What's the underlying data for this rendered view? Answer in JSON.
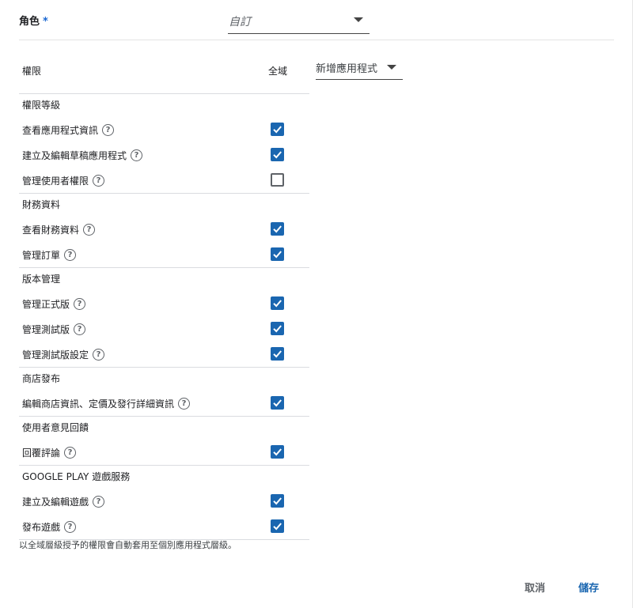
{
  "role": {
    "label": "角色",
    "required_mark": "*",
    "value": "自訂"
  },
  "app_select": {
    "value": "新增應用程式"
  },
  "table": {
    "header_permission": "權限",
    "header_global": "全域",
    "groups": [
      {
        "title": "權限等級",
        "items": [
          {
            "label": "查看應用程式資訊",
            "checked": true
          },
          {
            "label": "建立及編輯草稿應用程式",
            "checked": true
          },
          {
            "label": "管理使用者權限",
            "checked": false
          }
        ]
      },
      {
        "title": "財務資料",
        "items": [
          {
            "label": "查看財務資料",
            "checked": true
          },
          {
            "label": "管理訂單",
            "checked": true
          }
        ]
      },
      {
        "title": "版本管理",
        "items": [
          {
            "label": "管理正式版",
            "checked": true
          },
          {
            "label": "管理測試版",
            "checked": true
          },
          {
            "label": "管理測試版設定",
            "checked": true
          }
        ]
      },
      {
        "title": "商店發布",
        "items": [
          {
            "label": "編輯商店資訊、定價及發行詳細資訊",
            "checked": true
          }
        ]
      },
      {
        "title": "使用者意見回饋",
        "items": [
          {
            "label": "回覆評論",
            "checked": true
          }
        ]
      },
      {
        "title": "GOOGLE PLAY 遊戲服務",
        "items": [
          {
            "label": "建立及編輯遊戲",
            "checked": true
          },
          {
            "label": "發布遊戲",
            "checked": true
          }
        ]
      }
    ]
  },
  "help_glyph": "?",
  "footnote": "以全域層級授予的權限會自動套用至個別應用程式層級。",
  "buttons": {
    "cancel": "取消",
    "save": "儲存"
  },
  "colors": {
    "checkbox_checked": "#1a66b0",
    "save_button": "#1a66b0",
    "required_mark": "#1967d2"
  }
}
